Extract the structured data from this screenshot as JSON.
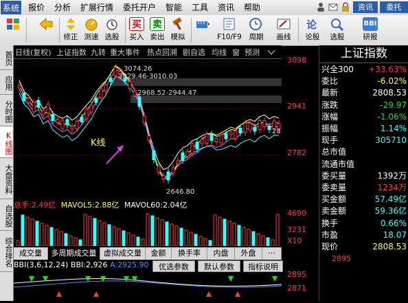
{
  "menu": {
    "items": [
      "系统",
      "报价",
      "分析",
      "扩展行情",
      "委托开户",
      "智能",
      "工具",
      "资讯",
      "帮助"
    ],
    "right_buttons": [
      "资讯",
      "委托"
    ]
  },
  "toolbar": {
    "buttons": [
      {
        "label": "",
        "icon": "grid-icon"
      },
      {
        "label": "",
        "icon": "back-arrow-icon"
      },
      {
        "label": "修正",
        "icon": "updown-arrow-icon"
      },
      {
        "label": "测速",
        "icon": "speedometer-icon"
      },
      {
        "label": "选股",
        "icon": "stopwatch-icon"
      },
      {
        "label": "买入",
        "icon": "buy-icon",
        "glyph": "买"
      },
      {
        "label": "卖出",
        "icon": "sell-icon",
        "glyph": "卖"
      },
      {
        "label": "模拟",
        "icon": "gavel-icon"
      },
      {
        "label": "",
        "icon": "ruler-icon"
      },
      {
        "label": "F10/F9",
        "icon": "f10-icon"
      },
      {
        "label": "周期",
        "icon": "clock-icon"
      },
      {
        "label": "画线",
        "icon": "pen-icon"
      },
      {
        "label": "论股",
        "icon": "forum-icon"
      },
      {
        "label": "选股",
        "icon": "magnifier-icon"
      },
      {
        "label": "研报",
        "icon": "report-icon"
      }
    ]
  },
  "sidebar": {
    "tabs": [
      "首页",
      "应用",
      "分时图",
      "K线图",
      "大盘资料",
      "自选股",
      "综合排名"
    ],
    "active": "K线图"
  },
  "chart_tabs": [
    "日线(复权)",
    "上证指数",
    "九转",
    "重大事件",
    "热点回溯",
    "剧自选",
    "均线",
    "窗",
    "预测"
  ],
  "kline": {
    "annotation": "K线",
    "peak_label": "3074.26",
    "range_label_1": "3029.46-3010.03",
    "range_label_2": "2968.52-2944.47",
    "low_label": "2646.80",
    "last_label": "2839"
  },
  "price_axis": [
    "3098",
    "2941",
    "2782"
  ],
  "volume": {
    "header_prefix": "总手:",
    "total": "2.49亿",
    "mavol5_label": "MAVOL5:",
    "mavol5": "2.88亿",
    "mavol60_label": "MAVOL60:",
    "mavol60": "2.04亿",
    "axis": [
      "4690",
      "3231",
      "X10"
    ]
  },
  "subtabs": [
    "成交量",
    "多周期成交量",
    "虚拟成交量",
    "金额",
    "换手率",
    "内盘",
    "外盘",
    "···"
  ],
  "subtab_active": "多周期成交量",
  "bbi": {
    "params": "BBI(3,6,12,24)",
    "label": "BBI:",
    "value": "2,926",
    "a_label": "A:",
    "a_value": "2925.90",
    "axis": [
      "2895",
      "2871"
    ],
    "buttons": [
      "优选参数",
      "默认参数",
      "指标说明"
    ]
  },
  "quote": {
    "title": "上证指数",
    "rows": [
      {
        "k": "兴全300",
        "v": "+33.63%",
        "c": "red"
      },
      {
        "k": "委比",
        "v": "-6.02%",
        "c": "yel"
      },
      {
        "k": "最新",
        "v": "2808.53",
        "c": "wht"
      },
      {
        "k": "涨跌",
        "v": "-29.97",
        "c": "grn"
      },
      {
        "k": "涨幅",
        "v": "-1.06%",
        "c": "grn"
      },
      {
        "k": "振幅",
        "v": "1.14%",
        "c": "cyn"
      },
      {
        "k": "现手",
        "v": "305710",
        "c": "cyn"
      },
      {
        "k": "总市值",
        "v": "",
        "c": "wht"
      },
      {
        "k": "流通市值",
        "v": "",
        "c": "wht"
      },
      {
        "k": "委买量",
        "v": "1392万",
        "c": "wht"
      },
      {
        "k": "委卖量",
        "v": "1234万",
        "c": "red"
      },
      {
        "k": "买金额",
        "v": "57.49亿",
        "c": "cyn"
      },
      {
        "k": "卖金额",
        "v": "59.36亿",
        "c": "cyn"
      },
      {
        "k": "换手",
        "v": "0.66%",
        "c": "cyn"
      },
      {
        "k": "市盈",
        "v": "18.07",
        "c": "cyn"
      },
      {
        "k": "现价",
        "v": "2808.53",
        "c": "yel"
      }
    ]
  },
  "colors": {
    "up": "#ff3b3b",
    "down": "#22dd22",
    "ma1": "#ffffff",
    "ma2": "#ffff00",
    "ma3": "#ff40ff",
    "ma4": "#40ffff"
  }
}
